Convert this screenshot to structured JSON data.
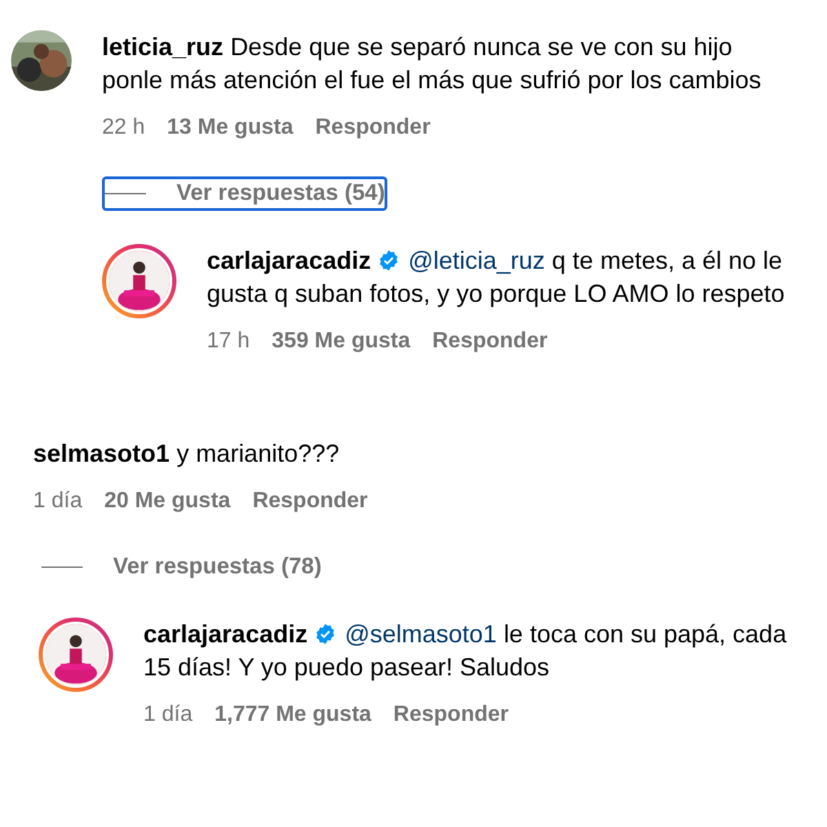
{
  "comments": [
    {
      "avatar": {
        "kind": "picture",
        "story_ring": false
      },
      "user": "leticia_ruz",
      "verified": false,
      "text": "Desde que se separó nunca se ve con su hijo ponle más atención el fue el más que sufrió por los cambios",
      "time": "22 h",
      "likes": "13 Me gusta",
      "reply": "Responder",
      "replies_toggle": {
        "label": "Ver respuestas (54)",
        "focused": true
      },
      "replies": [
        {
          "avatar": {
            "kind": "picture",
            "story_ring": true
          },
          "user": "carlajaracadiz",
          "verified": true,
          "mention": "@leticia_ruz",
          "text": "q te metes, a él no le gusta q suban fotos, y yo porque LO AMO lo respeto",
          "time": "17 h",
          "likes": "359 Me gusta",
          "reply": "Responder"
        }
      ]
    },
    {
      "user": "selmasoto1",
      "verified": false,
      "text": "y marianito???",
      "time": "1 día",
      "likes": "20 Me gusta",
      "reply": "Responder",
      "replies_toggle": {
        "label": "Ver respuestas (78)",
        "focused": false
      },
      "replies": [
        {
          "avatar": {
            "kind": "picture",
            "story_ring": true
          },
          "user": "carlajaracadiz",
          "verified": true,
          "mention": "@selmasoto1",
          "text": "le toca con su papá, cada 15 días! Y yo puedo pasear! Saludos",
          "time": "1 día",
          "likes": "1,777 Me gusta",
          "reply": "Responder"
        }
      ]
    }
  ]
}
